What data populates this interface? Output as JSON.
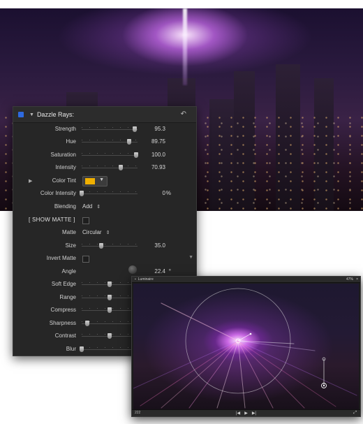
{
  "inspector": {
    "title": "Dazzle Rays:",
    "parameters": [
      {
        "label": "Strength",
        "control": "slider",
        "level": 0.95,
        "value": "95.3"
      },
      {
        "label": "Hue",
        "control": "slider",
        "level": 0.85,
        "value": "89.75"
      },
      {
        "label": "Saturation",
        "control": "slider",
        "level": 0.97,
        "value": "100.0"
      },
      {
        "label": "Intensity",
        "control": "slider",
        "level": 0.7,
        "value": "70.93"
      },
      {
        "label": "Color Tint",
        "control": "color",
        "swatch_color": "#f0b000"
      },
      {
        "label": "Color Intensity",
        "control": "slider",
        "level": 0.0,
        "value": "0",
        "unit": "%"
      },
      {
        "label": "Blending",
        "control": "popup",
        "value": "Add"
      },
      {
        "label": "[ SHOW MATTE ]",
        "control": "checkbox",
        "checked": false
      },
      {
        "label": "Matte",
        "control": "popup",
        "value": "Circular"
      },
      {
        "label": "Size",
        "control": "slider",
        "level": 0.35,
        "value": "35.0"
      },
      {
        "label": "Invert Matte",
        "control": "checkbox",
        "checked": false
      },
      {
        "label": "Angle",
        "control": "dial",
        "value": "22.4",
        "unit": "°"
      },
      {
        "label": "Soft Edge",
        "control": "slider",
        "level": 0.5
      },
      {
        "label": "Range",
        "control": "slider",
        "level": 0.5
      },
      {
        "label": "Compress",
        "control": "slider",
        "level": 0.5
      },
      {
        "label": "Sharpness",
        "control": "slider",
        "level": 0.1
      },
      {
        "label": "Contrast",
        "control": "slider",
        "level": 0.5
      },
      {
        "label": "Blur",
        "control": "slider",
        "level": 0.0
      }
    ]
  },
  "viewer": {
    "title": "Luminaire",
    "zoom": "47%",
    "close_symbol": "×",
    "timecode": "222",
    "prev_symbol": "|◀",
    "play_symbol": "▶",
    "next_symbol": "▶|",
    "fullscreen_symbol": "⤢"
  },
  "colors": {
    "accent": "#2e6ae0",
    "panel_bg": "#262626",
    "tint": "#f0b000"
  },
  "icons": {
    "enable": "enable-checkbox-icon",
    "disclosure": "triangle-down",
    "reset": "reset-arrow",
    "dropdown": "chevron-down",
    "popup_arrows": "up-down-arrows"
  }
}
